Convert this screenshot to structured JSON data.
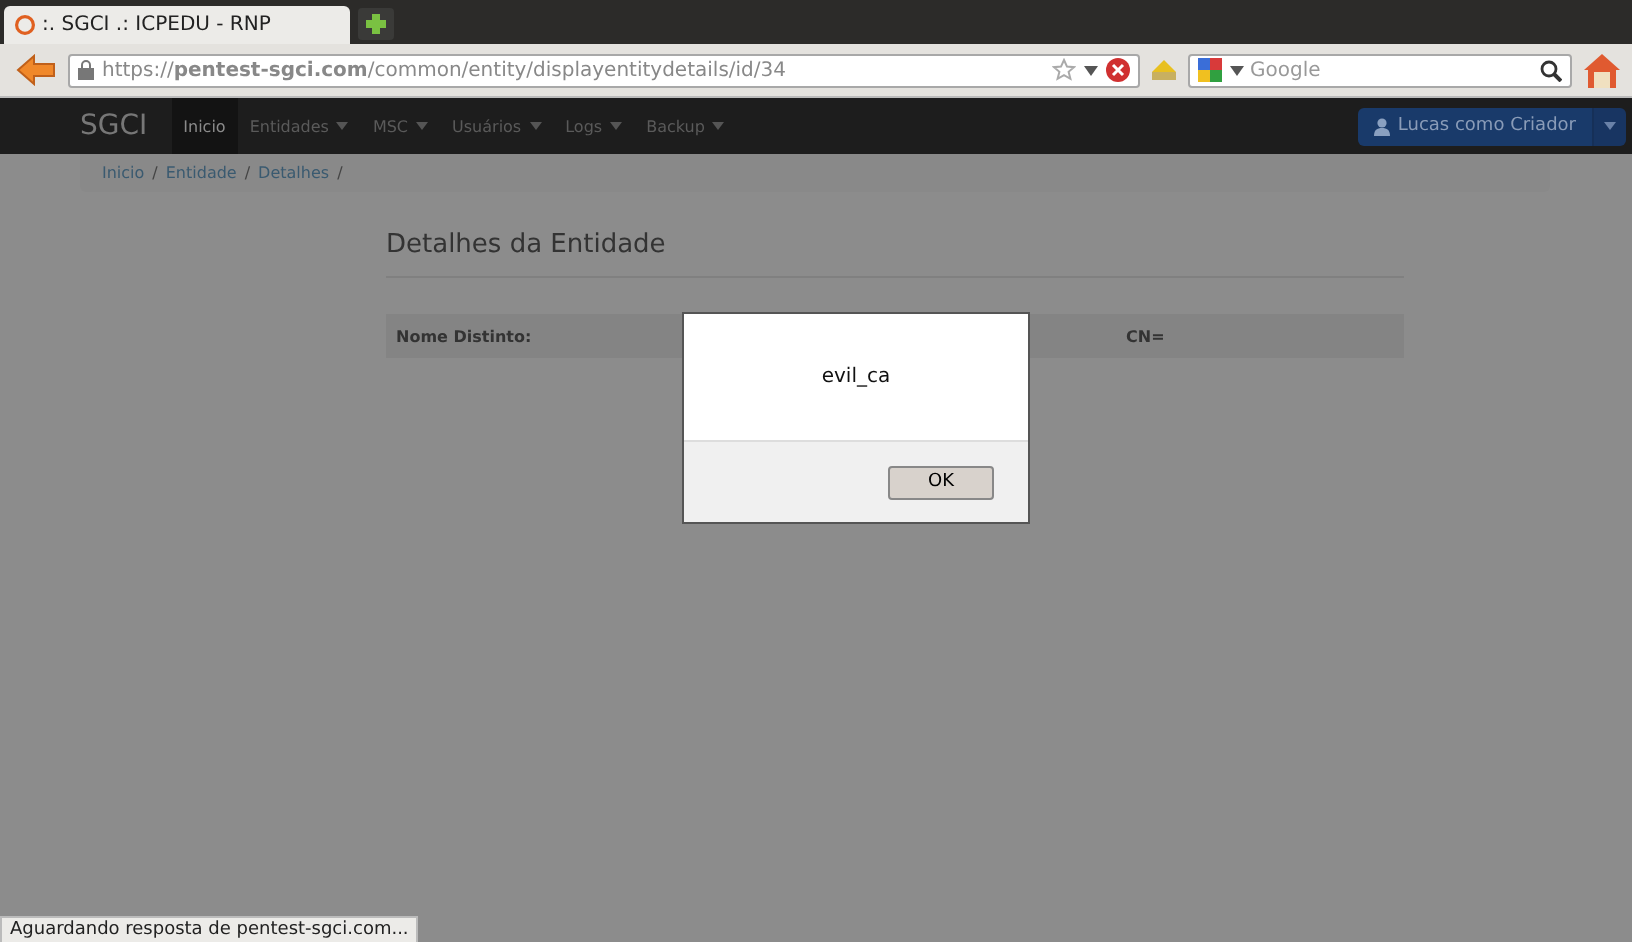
{
  "browser": {
    "tab": {
      "title": ":. SGCI .: ICPEDU - RNP",
      "selected": true
    },
    "url": "https://**pentest-sgci.com**/common/entity/displayentitydetails/id/34",
    "search": {
      "placeholder": "Google"
    }
  },
  "navbar": {
    "brand": "SGCI",
    "items": [
      {
        "label": "Inicio",
        "selected": true,
        "dropdown": false
      },
      {
        "label": "Entidades",
        "selected": false,
        "dropdown": true
      },
      {
        "label": "MSC",
        "selected": false,
        "dropdown": true
      },
      {
        "label": "Usuários",
        "selected": false,
        "dropdown": true
      },
      {
        "label": "Logs",
        "selected": false,
        "dropdown": true
      },
      {
        "label": "Backup",
        "selected": false,
        "dropdown": true
      }
    ],
    "user": "Lucas como Criador"
  },
  "breadcrumb": [
    {
      "label": "Inicio",
      "separator": "/"
    },
    {
      "label": "Entidade",
      "separator": "/"
    },
    {
      "label": "Detalhes",
      "separator": "/"
    }
  ],
  "page": {
    "title": "Detalhes da Entidade",
    "row": {
      "label": "Nome Distinto:",
      "value": "CN="
    }
  },
  "dialog": {
    "message": "evil_ca",
    "button": "OK"
  },
  "status_bar": "Aguardando resposta de pentest-sgci.com..."
}
